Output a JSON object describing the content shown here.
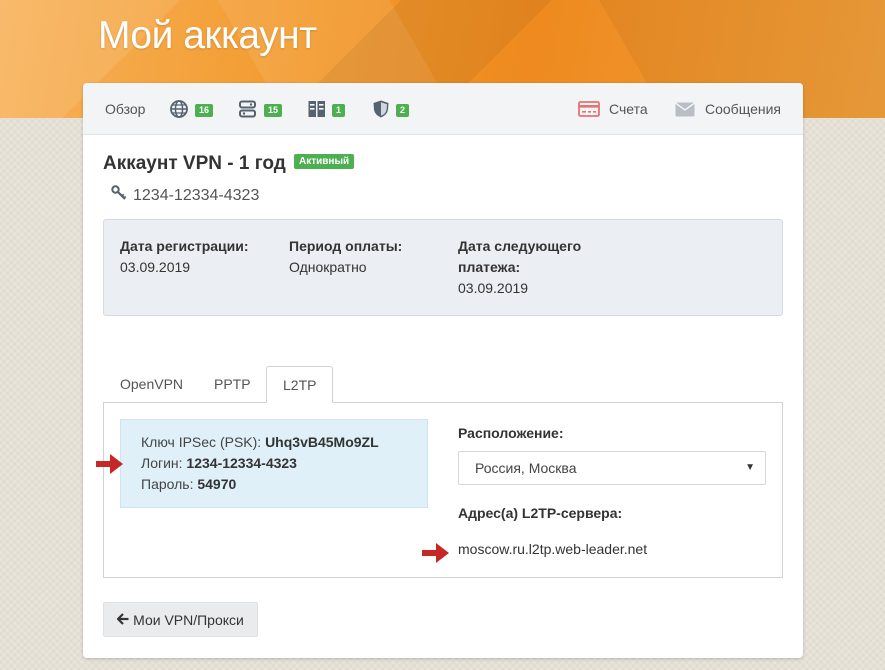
{
  "page": {
    "title": "Мой аккаунт"
  },
  "nav": {
    "overview_label": "Обзор",
    "badges": {
      "globe": "16",
      "servers": "15",
      "storage": "1",
      "shield": "2"
    },
    "invoices_label": "Счета",
    "messages_label": "Сообщения"
  },
  "account": {
    "title": "Аккаунт VPN - 1 год",
    "status": "Активный",
    "id": "1234-12334-4323"
  },
  "info": {
    "reg_label": "Дата регистрации:",
    "reg_value": "03.09.2019",
    "period_label": "Период оплаты:",
    "period_value": "Однократно",
    "next_label_1": "Дата следующего",
    "next_label_2": "платежа:",
    "next_value": "03.09.2019"
  },
  "tabs": [
    "OpenVPN",
    "PPTP",
    "L2TP"
  ],
  "l2tp": {
    "psk_label": "Ключ IPSec (PSK):",
    "psk_value": "Uhq3vB45Mo9ZL",
    "login_label": "Логин:",
    "login_value": "1234-12334-4323",
    "password_label": "Пароль:",
    "password_value": "54970",
    "location_label": "Расположение:",
    "location_value": "Россия, Москва",
    "server_label": "Адрес(а) L2TP-сервера:",
    "server_value": "moscow.ru.l2tp.web-leader.net"
  },
  "back_button": "Мои VPN/Прокси",
  "colors": {
    "accent_orange": "#f29a2e",
    "badge_green": "#4caf50",
    "arrow_red": "#c62828",
    "invoice_red": "#e57373"
  },
  "icons": {
    "globe": "globe-icon",
    "servers": "servers-icon",
    "storage": "storage-icon",
    "shield": "shield-icon",
    "invoices": "invoice-icon",
    "messages": "envelope-icon",
    "key": "key-icon",
    "back": "arrow-left-icon"
  }
}
